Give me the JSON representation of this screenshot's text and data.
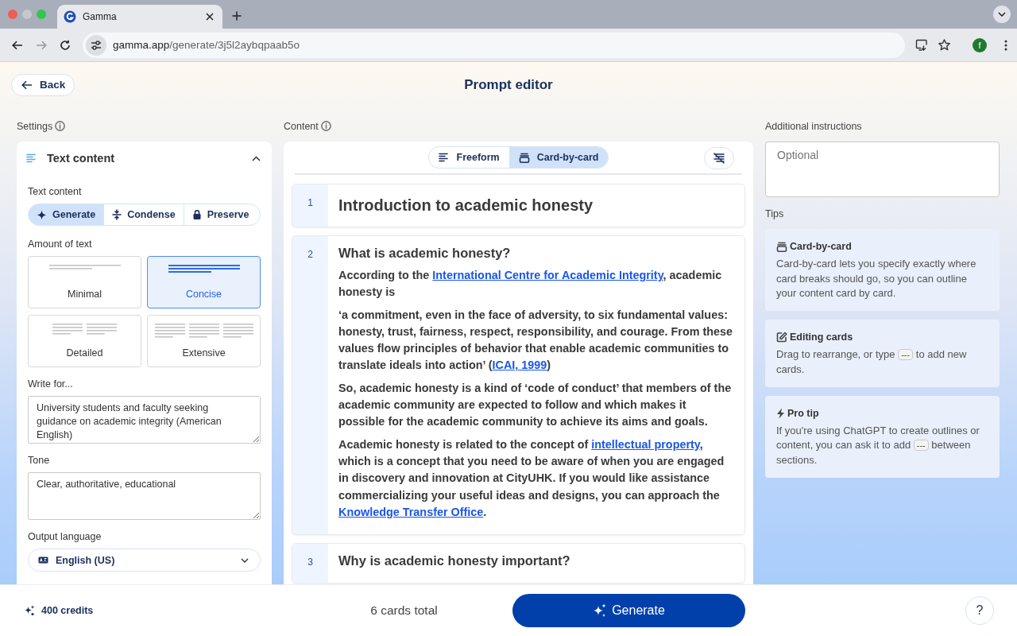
{
  "browser": {
    "tab_title": "Gamma",
    "url_host": "gamma.app",
    "url_path": "/generate/3j5l2aybqpaab5o",
    "avatar": "f"
  },
  "header": {
    "back": "Back",
    "title": "Prompt editor"
  },
  "settings": {
    "label": "Settings",
    "section_title": "Text content",
    "expanded": true,
    "text_content_label": "Text content",
    "modes": [
      {
        "kind": "generate",
        "label": "Generate",
        "selected": true
      },
      {
        "kind": "condense",
        "label": "Condense",
        "selected": false
      },
      {
        "kind": "preserve",
        "label": "Preserve",
        "selected": false
      }
    ],
    "amount_label": "Amount of text",
    "amounts": [
      {
        "kind": "minimal",
        "label": "Minimal",
        "selected": false
      },
      {
        "kind": "concise",
        "label": "Concise",
        "selected": true
      },
      {
        "kind": "detailed",
        "label": "Detailed",
        "selected": false
      },
      {
        "kind": "extensive",
        "label": "Extensive",
        "selected": false
      }
    ],
    "write_for_label": "Write for...",
    "write_for_value": "University students and faculty seeking guidance on academic integrity (American English)",
    "tone_label": "Tone",
    "tone_value": "Clear, authoritative, educational",
    "language_label": "Output language",
    "language_value": "English (US)"
  },
  "content": {
    "label": "Content",
    "view_tabs": [
      {
        "kind": "freeform",
        "label": "Freeform",
        "selected": false
      },
      {
        "kind": "cards",
        "label": "Card-by-card",
        "selected": true
      }
    ],
    "cards": [
      {
        "number": "1",
        "kind": "title",
        "title": "Introduction to academic honesty"
      },
      {
        "number": "2",
        "kind": "section",
        "title": "What is academic honesty?",
        "paragraphs": [
          [
            {
              "text": "According to the "
            },
            {
              "text": "International Centre for Academic Integrity",
              "link": true
            },
            {
              "text": ", academic honesty is"
            }
          ],
          [
            {
              "text": "‘a commitment, even in the face of adversity, to six fundamental values: honesty, trust, fairness, respect, responsibility, and courage. From these values flow principles of behavior that enable academic communities to translate ideals into action’ ("
            },
            {
              "text": "ICAI, 1999",
              "link": true
            },
            {
              "text": ")"
            }
          ],
          [
            {
              "text": "So, academic honesty is a kind of ‘code of conduct’ that members of the academic community are expected to follow and which makes it possible for the academic community to achieve its aims and goals."
            }
          ],
          [
            {
              "text": "Academic honesty is related to the concept of "
            },
            {
              "text": "intellectual property",
              "link": true
            },
            {
              "text": ", which is a concept that you need to be aware of when you are engaged in discovery and innovation at CityUHK. If you would like assistance commercializing your useful ideas and designs, you can approach the "
            },
            {
              "text": "Knowledge Transfer Office",
              "link": true
            },
            {
              "text": "."
            }
          ]
        ]
      },
      {
        "number": "3",
        "kind": "section",
        "title": "Why is academic honesty important?"
      }
    ]
  },
  "instructions": {
    "label": "Additional instructions",
    "placeholder": "Optional",
    "tips_label": "Tips",
    "tips": [
      {
        "kind": "cards",
        "title": "Card-by-card",
        "body": [
          {
            "text": "Card-by-card lets you specify exactly where card breaks should go, so you can outline your content card by card."
          }
        ]
      },
      {
        "kind": "edit",
        "title": "Editing cards",
        "body": [
          {
            "text": "Drag to rearrange, or type "
          },
          {
            "text": "---",
            "code": true
          },
          {
            "text": " to add new cards."
          }
        ]
      },
      {
        "kind": "bolt",
        "title": "Pro tip",
        "body": [
          {
            "text": "If you're using ChatGPT to create outlines or content, you can ask it to add "
          },
          {
            "text": "---",
            "code": true
          },
          {
            "text": " between sections."
          }
        ]
      }
    ]
  },
  "footer": {
    "credits": "400 credits",
    "total": "6 cards total",
    "generate": "Generate",
    "help": "?"
  }
}
